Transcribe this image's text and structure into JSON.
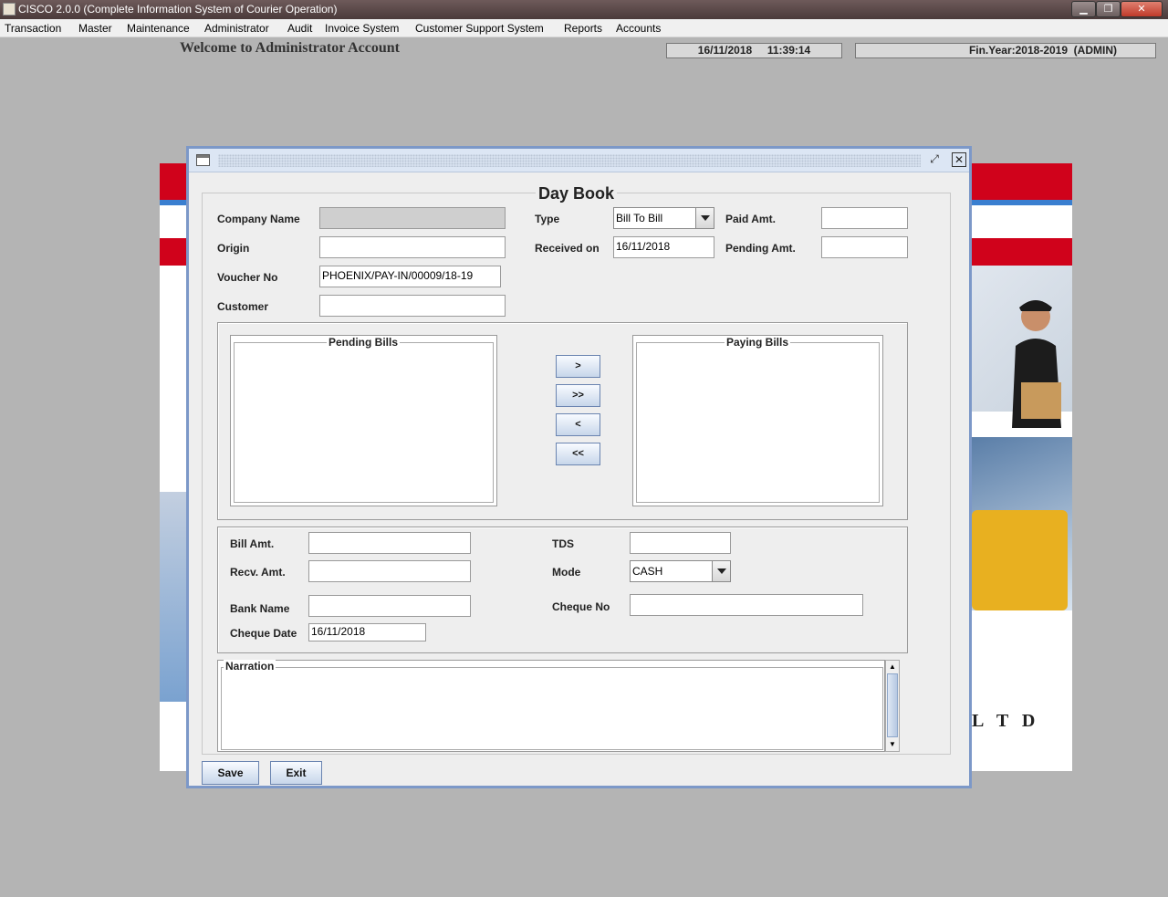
{
  "os_window": {
    "title": "CISCO 2.0.0 (Complete Information System of Courier Operation)",
    "buttons": [
      "minimize",
      "restore",
      "close"
    ]
  },
  "menu": [
    "Transaction",
    "Master",
    "Maintenance",
    "Administrator",
    "Audit",
    "Invoice System",
    "Customer Support System",
    "Reports",
    "Accounts"
  ],
  "header": {
    "welcome": "Welcome to Administrator Account",
    "datetime": "16/11/2018     11:39:14",
    "fin_year": "Fin.Year:2018-2019  (ADMIN)"
  },
  "banner": {
    "ltd_text": "L T D"
  },
  "form": {
    "title": "Day Book",
    "company_name_label": "Company Name",
    "company_name_value": "",
    "origin_label": "Origin",
    "origin_value": "",
    "voucher_no_label": "Voucher No",
    "voucher_no_value": "PHOENIX/PAY-IN/00009/18-19",
    "customer_label": "Customer",
    "customer_value": "",
    "type_label": "Type",
    "type_value": "Bill To Bill",
    "received_on_label": "Received on",
    "received_on_value": "16/11/2018",
    "paid_amt_label": "Paid Amt.",
    "paid_amt_value": "",
    "pending_amt_label": "Pending Amt.",
    "pending_amt_value": "",
    "pending_bills_label": "Pending Bills",
    "paying_bills_label": "Paying Bills",
    "nav_buttons": [
      ">",
      ">>",
      "<",
      "<<"
    ],
    "bill_amt_label": "Bill Amt.",
    "recv_amt_label": "Recv. Amt.",
    "bank_name_label": "Bank Name",
    "cheque_date_label": "Cheque Date",
    "cheque_date_value": "16/11/2018",
    "tds_label": "TDS",
    "mode_label": "Mode",
    "mode_value": "CASH",
    "cheque_no_label": "Cheque No",
    "narration_label": "Narration",
    "save_label": "Save",
    "exit_label": "Exit"
  },
  "colors": {
    "frame_border": "#7c98c8",
    "banner_red": "#d0021b",
    "button_gradient_bottom": "#c7d6ea"
  }
}
